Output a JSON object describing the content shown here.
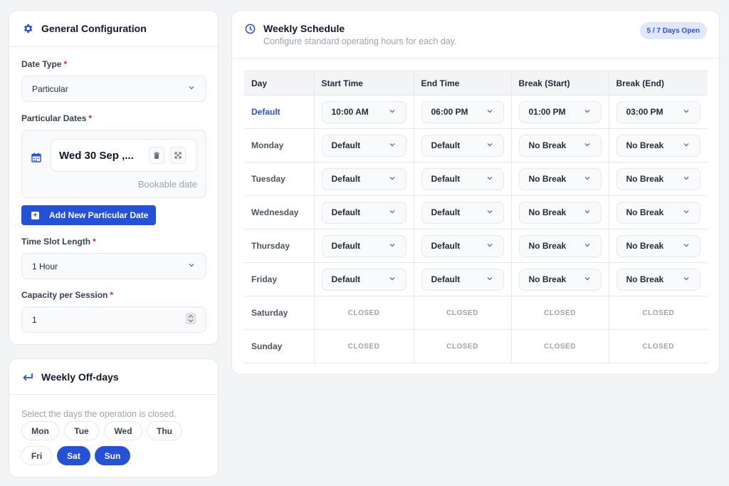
{
  "general": {
    "title": "General Configuration",
    "date_type_label": "Date Type",
    "date_type_value": "Particular",
    "particular_dates_label": "Particular Dates",
    "date_chip_text": "Wed 30 Sep ,...",
    "bookable_label": "Bookable date",
    "add_button_label": "Add New Particular Date",
    "slot_length_label": "Time Slot Length",
    "slot_length_value": "1 Hour",
    "capacity_label": "Capacity per Session",
    "capacity_value": "1",
    "required_mark": "*"
  },
  "offdays": {
    "title": "Weekly Off-days",
    "hint": "Select the days the operation is closed.",
    "days": [
      {
        "label": "Mon",
        "active": false
      },
      {
        "label": "Tue",
        "active": false
      },
      {
        "label": "Wed",
        "active": false
      },
      {
        "label": "Thu",
        "active": false
      },
      {
        "label": "Fri",
        "active": false
      },
      {
        "label": "Sat",
        "active": true
      },
      {
        "label": "Sun",
        "active": true
      }
    ]
  },
  "schedule": {
    "title": "Weekly Schedule",
    "subtitle": "Configure standard operating hours for each day.",
    "badge": "5 / 7 Days Open",
    "columns": [
      "Day",
      "Start Time",
      "End Time",
      "Break (Start)",
      "Break (End)"
    ],
    "closed_label": "CLOSED",
    "rows": [
      {
        "day": "Default",
        "cells": [
          "10:00 AM",
          "06:00 PM",
          "01:00 PM",
          "03:00 PM"
        ],
        "closed": false
      },
      {
        "day": "Monday",
        "cells": [
          "Default",
          "Default",
          "No Break",
          "No Break"
        ],
        "closed": false
      },
      {
        "day": "Tuesday",
        "cells": [
          "Default",
          "Default",
          "No Break",
          "No Break"
        ],
        "closed": false
      },
      {
        "day": "Wednesday",
        "cells": [
          "Default",
          "Default",
          "No Break",
          "No Break"
        ],
        "closed": false
      },
      {
        "day": "Thursday",
        "cells": [
          "Default",
          "Default",
          "No Break",
          "No Break"
        ],
        "closed": false
      },
      {
        "day": "Friday",
        "cells": [
          "Default",
          "Default",
          "No Break",
          "No Break"
        ],
        "closed": false
      },
      {
        "day": "Saturday",
        "cells": [],
        "closed": true
      },
      {
        "day": "Sunday",
        "cells": [],
        "closed": true
      }
    ]
  },
  "colors": {
    "accent": "#2352d8",
    "required": "#dc2626",
    "muted": "#9ca3af"
  },
  "icons": {
    "config": "gear-icon",
    "offdays": "return-arrow-icon",
    "schedule": "clock-icon",
    "calendar": "calendar-icon",
    "delete": "trash-icon",
    "expand": "expand-icon",
    "chevron": "chevron-down-icon",
    "add": "plus-square-icon",
    "stepper": "stepper-icon"
  }
}
